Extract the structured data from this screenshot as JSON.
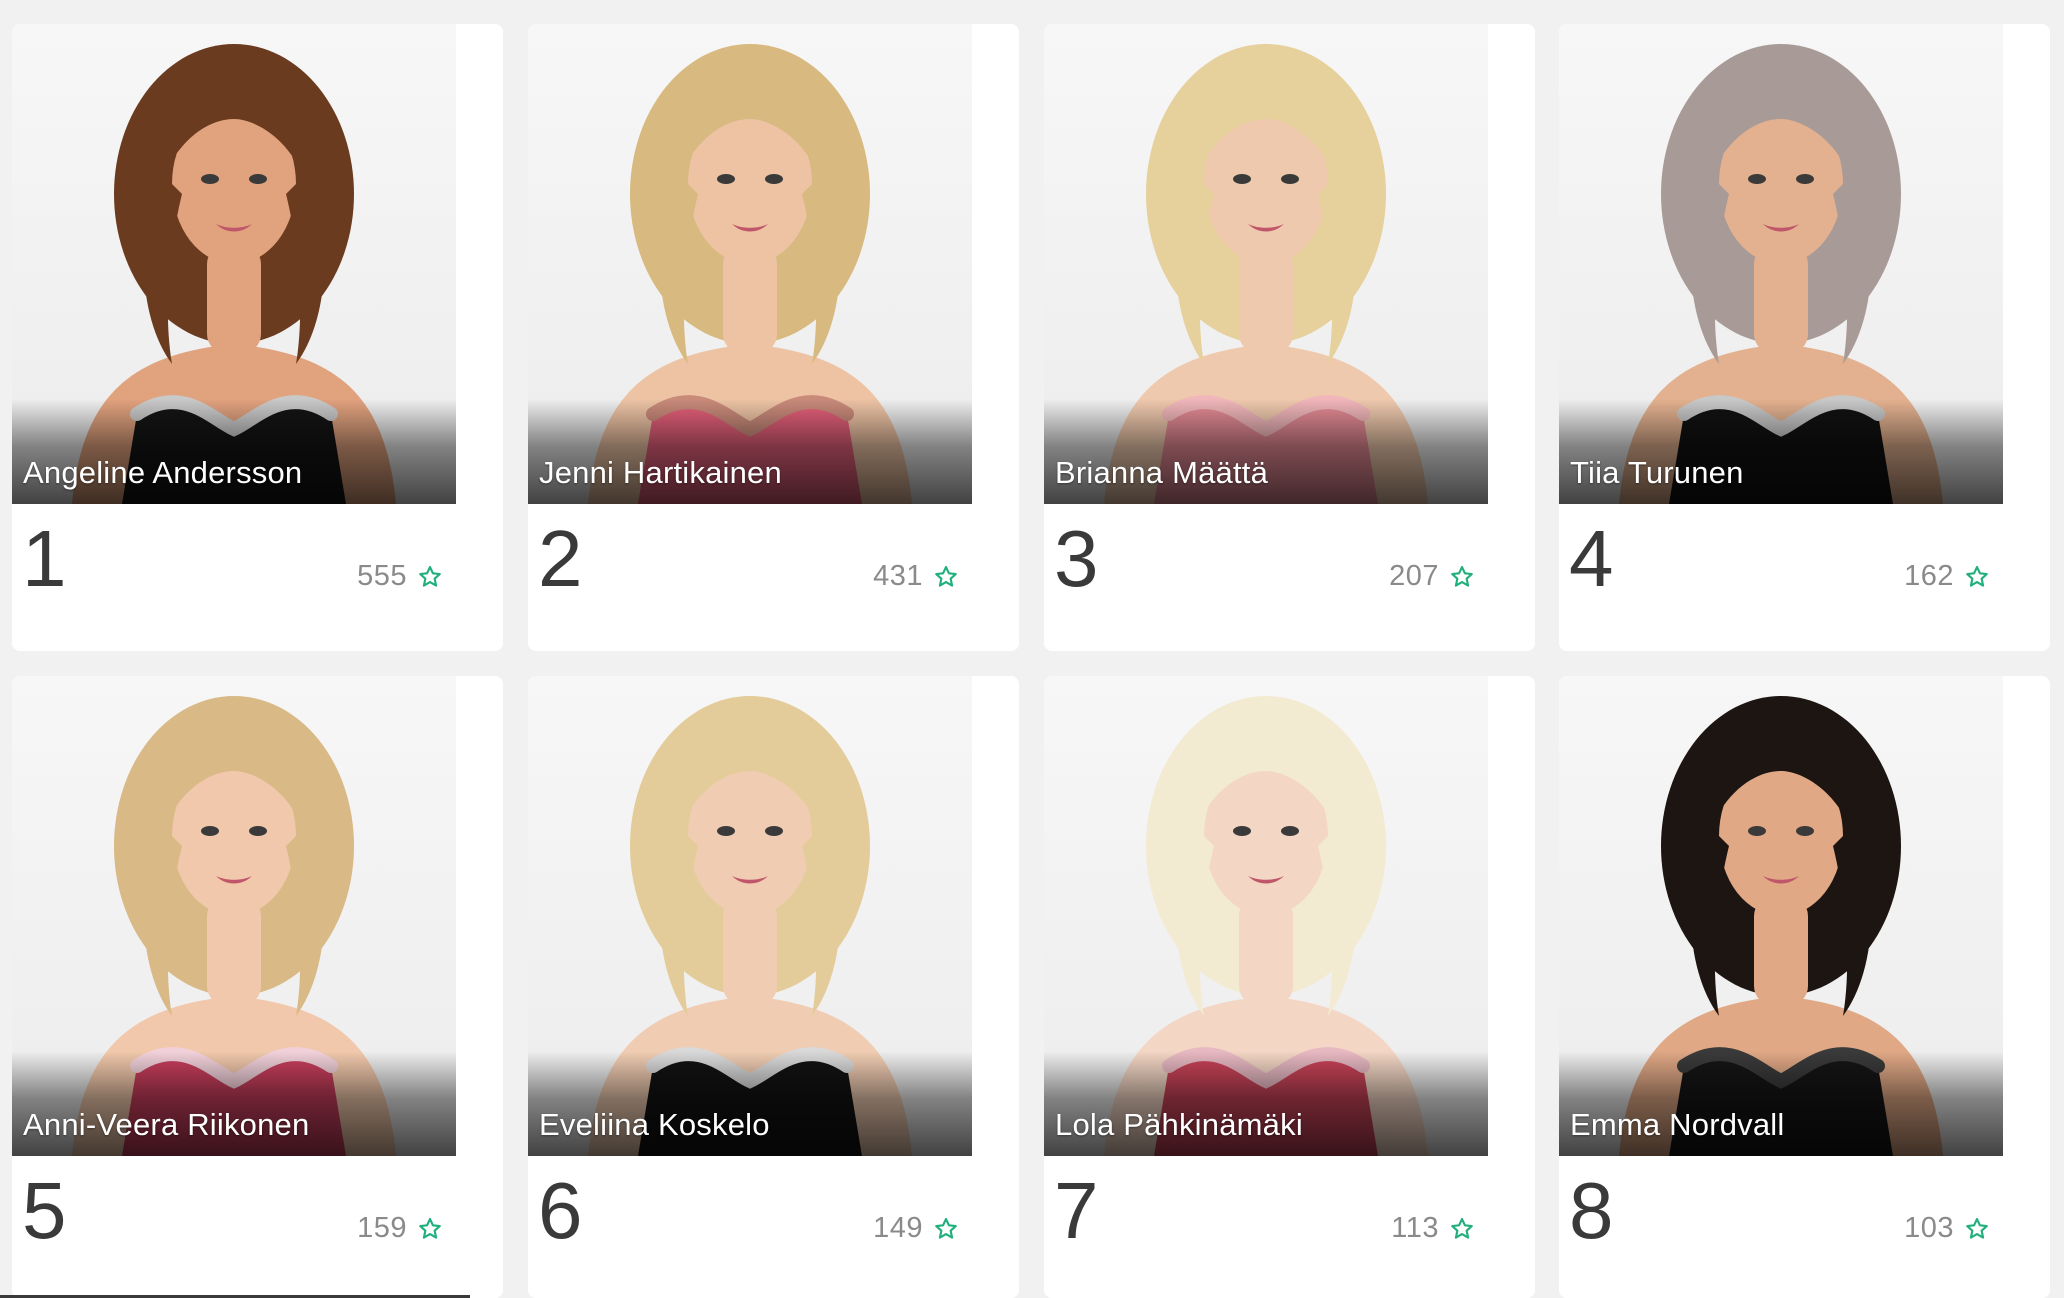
{
  "accent_color": "#22b07d",
  "contestants": [
    {
      "rank": "1",
      "name": "Angeline Andersson",
      "votes": "555",
      "hair": "#6b3b1f",
      "dress": "#141414",
      "trim": "#c9c9c9",
      "skin": "#e1a27e"
    },
    {
      "rank": "2",
      "name": "Jenni Hartikainen",
      "votes": "431",
      "hair": "#d8b97f",
      "dress": "#e4607a",
      "trim": "#c98a7a",
      "skin": "#edc3a4"
    },
    {
      "rank": "3",
      "name": "Brianna Määttä",
      "votes": "207",
      "hair": "#e6d09c",
      "dress": "#e48a94",
      "trim": "#f0b6ba",
      "skin": "#efc9ad"
    },
    {
      "rank": "4",
      "name": "Tiia Turunen",
      "votes": "162",
      "hair": "#a89a97",
      "dress": "#111111",
      "trim": "#c8c8c8",
      "skin": "#e3b18f"
    },
    {
      "rank": "5",
      "name": "Anni-Veera Riikonen",
      "votes": "159",
      "hair": "#d9b985",
      "dress": "#c83e5c",
      "trim": "#f2d0da",
      "skin": "#f1c8ab"
    },
    {
      "rank": "6",
      "name": "Eveliina Koskelo",
      "votes": "149",
      "hair": "#e3cc9a",
      "dress": "#121212",
      "trim": "#d9d9d9",
      "skin": "#f0ccb2"
    },
    {
      "rank": "7",
      "name": "Lola Pähkinämäki",
      "votes": "113",
      "hair": "#f3ead2",
      "dress": "#c84358",
      "trim": "#e7b8c2",
      "skin": "#f3d6c4"
    },
    {
      "rank": "8",
      "name": "Emma Nordvall",
      "votes": "103",
      "hair": "#1d1512",
      "dress": "#151515",
      "trim": "#3a3a3a",
      "skin": "#e0a885"
    }
  ]
}
